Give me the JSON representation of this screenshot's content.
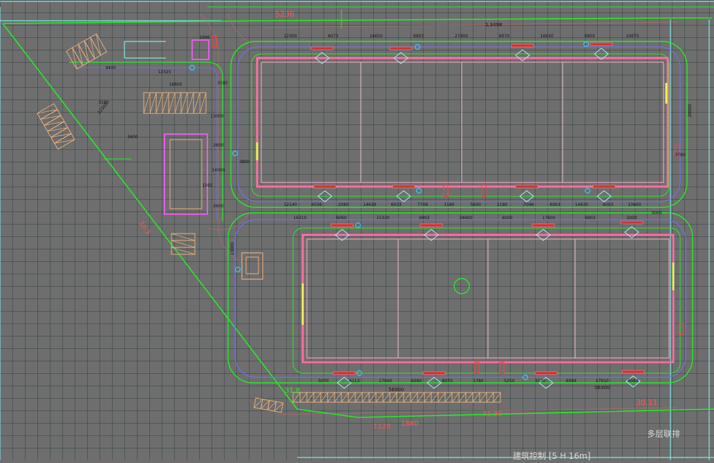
{
  "colors": {
    "background": "#6e6e6e",
    "grid": "#2f3f3f",
    "frame": "#7fe6e6",
    "boundary": "#22ee22",
    "road_edge": "#22ee22",
    "road_center": "#7070ee",
    "building": "#ff6fa0",
    "parking": "#e7b07a",
    "dimension": "#111111",
    "label_red": "#ff5555",
    "hydrant": "#33ccff",
    "yellow": "#f2f25a"
  },
  "labels": {
    "road_top": "5236",
    "total_top": "1,3498",
    "b1_top": [
      "12300",
      "6073",
      "14650",
      "6903",
      "27900",
      "6070",
      "16630",
      "6903",
      "10675"
    ],
    "b1_bottom": [
      "12140",
      "6036",
      "2080",
      "14630",
      "6033",
      "7706",
      "1180",
      "5930",
      "1180",
      "7046",
      "6003",
      "14630",
      "6003",
      "10600"
    ],
    "b2_top": [
      "16310",
      "6060",
      "15330",
      "6903",
      "24600",
      "6000",
      "17600",
      "6903",
      "5000"
    ],
    "b2_bottom": [
      "5070",
      "6113",
      "17940",
      "6090",
      "8070",
      "1780",
      "5250",
      "3130",
      "6094",
      "17910",
      "6063"
    ],
    "b2_total": "56900",
    "b2_total_right": "56300",
    "west": [
      "1996",
      "9400",
      "12325",
      "16600",
      "3185",
      "3800",
      "5600",
      "13000",
      "2600",
      "14000",
      "1565",
      "2600",
      "3180"
    ],
    "vertical_dims": [
      "22300",
      "20000",
      "13000",
      "3780",
      "3000"
    ],
    "bottom_note": "多层联排",
    "bottom_text": "建筑控制 [5 H 16m]",
    "side_code": "30.3",
    "bottom_code_a": "31.8",
    "bottom_code_b": "30.11",
    "bottom_code_c": "1120",
    "bottom_code_d": "1880",
    "bottom_code_e": "31.30"
  }
}
